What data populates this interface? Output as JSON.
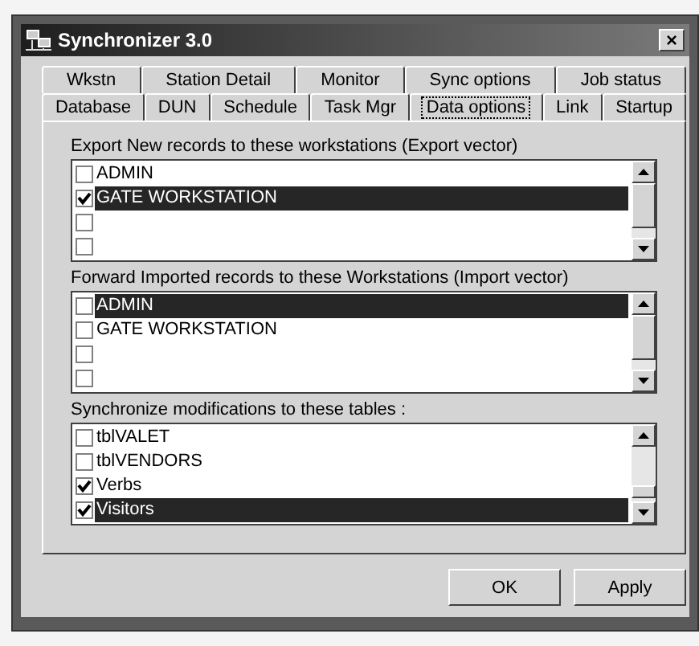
{
  "window": {
    "title": "Synchronizer 3.0",
    "close": "×"
  },
  "tab_rows": [
    {
      "tabs": [
        {
          "label": "Wkstn",
          "selected": false
        },
        {
          "label": "Station Detail",
          "selected": false
        },
        {
          "label": "Monitor",
          "selected": false
        },
        {
          "label": "Sync options",
          "selected": false
        },
        {
          "label": "Job status",
          "selected": false
        }
      ]
    },
    {
      "tabs": [
        {
          "label": "Database",
          "selected": false
        },
        {
          "label": "DUN",
          "selected": false
        },
        {
          "label": "Schedule",
          "selected": false
        },
        {
          "label": "Task Mgr",
          "selected": false
        },
        {
          "label": "Data options",
          "selected": true
        },
        {
          "label": "Link",
          "selected": false
        },
        {
          "label": "Startup",
          "selected": false
        }
      ]
    }
  ],
  "lists": [
    {
      "label": "Export New records to these workstations  (Export vector)",
      "items": [
        {
          "label": "ADMIN",
          "checked": false,
          "selected": false
        },
        {
          "label": "GATE WORKSTATION",
          "checked": true,
          "selected": true
        },
        {
          "checked": false,
          "selected": false
        },
        {
          "checked": false,
          "selected": false
        }
      ]
    },
    {
      "label": "Forward  Imported records to these Workstations (Import vector)",
      "items": [
        {
          "label": "ADMIN",
          "checked": false,
          "selected": true
        },
        {
          "label": "GATE WORKSTATION",
          "checked": false,
          "selected": false
        },
        {
          "checked": false,
          "selected": false
        },
        {
          "checked": false,
          "selected": false
        }
      ]
    },
    {
      "label": "Synchronize modifications to these tables :",
      "items": [
        {
          "label": "tblVALET",
          "checked": false,
          "selected": false
        },
        {
          "label": "tblVENDORS",
          "checked": false,
          "selected": false
        },
        {
          "label": "Verbs",
          "checked": true,
          "selected": false
        },
        {
          "label": "Visitors",
          "checked": true,
          "selected": true
        }
      ]
    }
  ],
  "buttons": [
    "OK",
    "Apply"
  ]
}
